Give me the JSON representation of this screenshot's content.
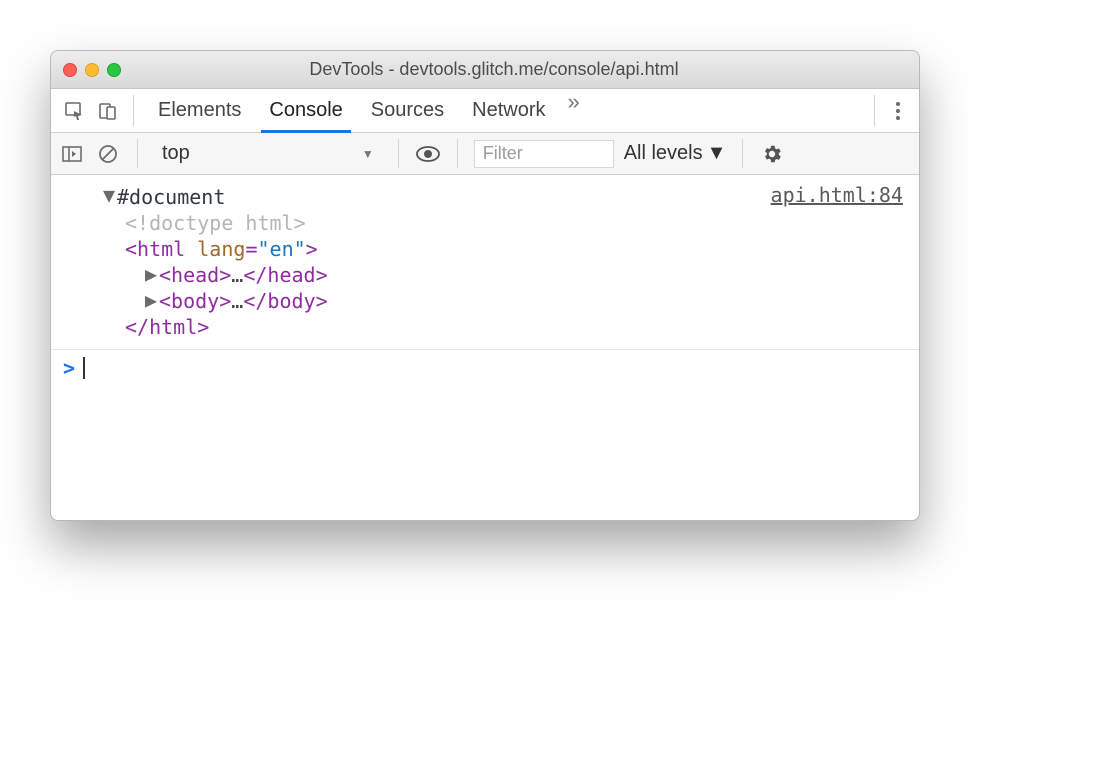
{
  "window": {
    "title": "DevTools - devtools.glitch.me/console/api.html"
  },
  "tabs": {
    "elements": "Elements",
    "console": "Console",
    "sources": "Sources",
    "network": "Network"
  },
  "subbar": {
    "context": "top",
    "filter_placeholder": "Filter",
    "levels": "All levels"
  },
  "log": {
    "source": "api.html:84",
    "root": "#document",
    "doctype": "<!doctype html>",
    "html_open_tag": "html",
    "html_attr": "lang",
    "html_val": "\"en\"",
    "head_tag": "head",
    "body_tag": "body",
    "ellipsis": "…",
    "html_close_tag": "html"
  },
  "prompt": {
    "symbol": ">"
  }
}
